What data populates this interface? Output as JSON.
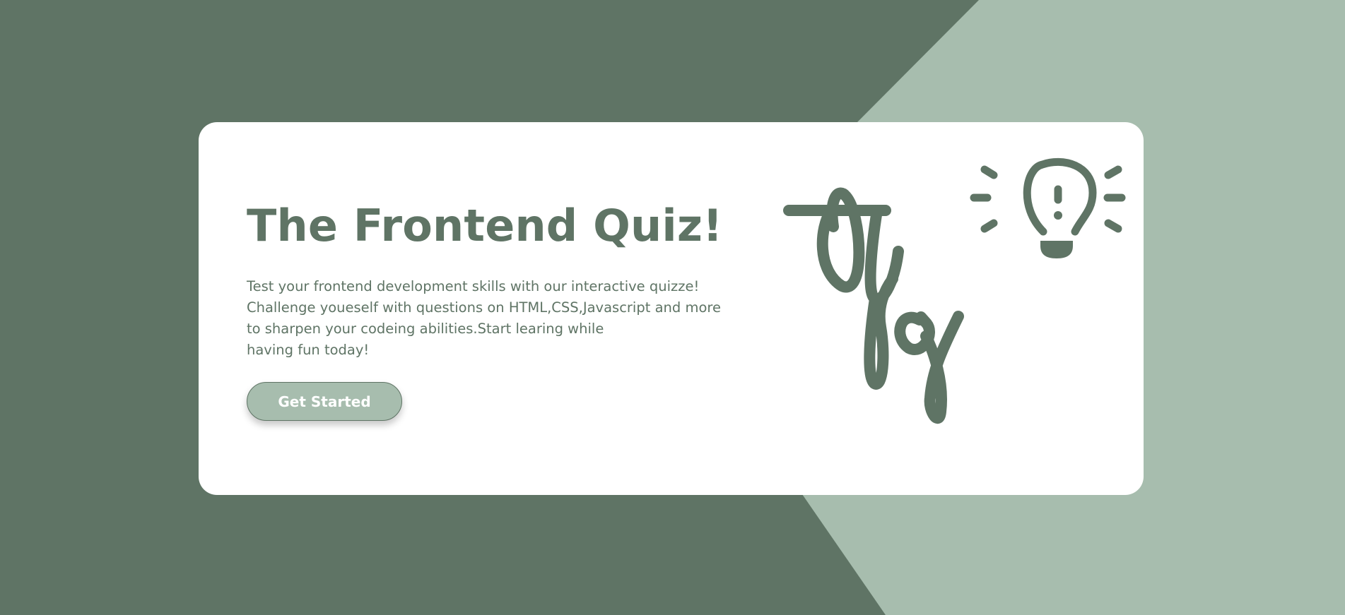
{
  "colors": {
    "dark_green": "#5f7465",
    "light_green": "#a7bdae",
    "card": "#ffffff",
    "text": "#5f7465",
    "button_bg": "#a7bdae",
    "button_text": "#ffffff"
  },
  "hero": {
    "title": "The Frontend Quiz!",
    "description_lines": [
      "Test your frontend development skills with our interactive quizze!",
      "Challenge youeself with questions on HTML,CSS,Javascript and more",
      "to sharpen your codeing abilities.Start learing while",
      "having fun today!"
    ],
    "cta_label": "Get Started"
  },
  "illustration": {
    "logo_icon": "handwritten-tfq-monogram",
    "idea_icon": "lightbulb-exclamation-icon"
  }
}
